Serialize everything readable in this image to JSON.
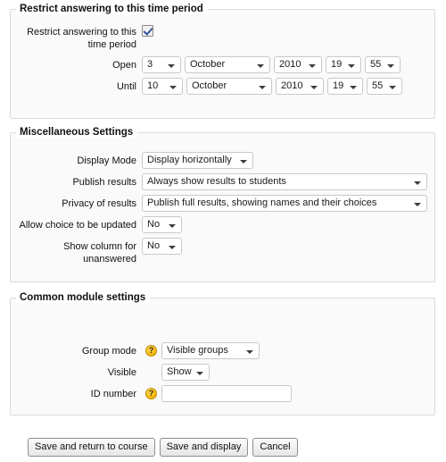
{
  "accent": "#f5b914",
  "sections": {
    "restrict": {
      "legend": "Restrict answering to this time period",
      "checkbox_label": "Restrict answering to this time period",
      "checkbox_checked": "checked",
      "open_label": "Open",
      "until_label": "Until",
      "open": {
        "day": "3",
        "month": "October",
        "year": "2010",
        "hour": "19",
        "minute": "55"
      },
      "until": {
        "day": "10",
        "month": "October",
        "year": "2010",
        "hour": "19",
        "minute": "55"
      }
    },
    "misc": {
      "legend": "Miscellaneous Settings",
      "display_mode_label": "Display Mode",
      "display_mode_value": "Display horizontally",
      "publish_results_label": "Publish results",
      "publish_results_value": "Always show results to students",
      "privacy_label": "Privacy of results",
      "privacy_value": "Publish full results, showing names and their choices",
      "allow_update_label": "Allow choice to be updated",
      "allow_update_value": "No",
      "show_unanswered_label": "Show column for unanswered",
      "show_unanswered_value": "No"
    },
    "common": {
      "legend": "Common module settings",
      "group_mode_label": "Group mode",
      "group_mode_value": "Visible groups",
      "group_mode_help": "?",
      "visible_label": "Visible",
      "visible_value": "Show",
      "idnumber_label": "ID number",
      "idnumber_help": "?",
      "idnumber_value": "",
      "idnumber_placeholder": ""
    }
  },
  "buttons": {
    "save_return": "Save and return to course",
    "save_display": "Save and display",
    "cancel": "Cancel"
  }
}
